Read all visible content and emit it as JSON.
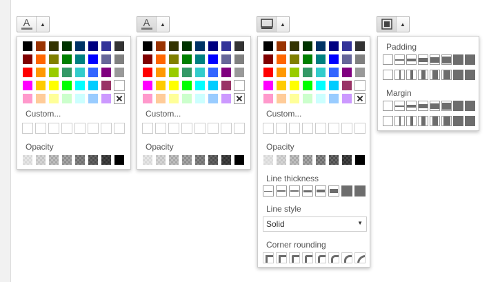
{
  "toolbar": {
    "font_color_button": "font-color-button",
    "bg_color_button": "background-color-button",
    "border_button": "border-button",
    "spacing_button": "spacing-button"
  },
  "colors": {
    "palette": [
      "#000000",
      "#993300",
      "#333300",
      "#003300",
      "#003366",
      "#000080",
      "#333399",
      "#333333",
      "#800000",
      "#ff6600",
      "#808000",
      "#008000",
      "#008080",
      "#0000ff",
      "#666699",
      "#808080",
      "#ff0000",
      "#ff9900",
      "#99cc00",
      "#339966",
      "#33cccc",
      "#3366ff",
      "#800080",
      "#999999",
      "#ff00ff",
      "#ffcc00",
      "#ffff00",
      "#00ff00",
      "#00ffff",
      "#00ccff",
      "#993366",
      "#ffffff",
      "#ff99cc",
      "#ffcc99",
      "#ffff99",
      "#ccffcc",
      "#ccffff",
      "#99ccff",
      "#cc99ff",
      "none"
    ],
    "opacity_shades": [
      "#d8d8d8",
      "#c4c4c4",
      "#a8a8a8",
      "#8c8c8c",
      "#6c6c6c",
      "#4c4c4c",
      "#2e2e2e",
      "#000000"
    ]
  },
  "popup1": {
    "custom_label": "Custom...",
    "opacity_label": "Opacity"
  },
  "popup2": {
    "custom_label": "Custom...",
    "opacity_label": "Opacity"
  },
  "popup3": {
    "custom_label": "Custom...",
    "opacity_label": "Opacity",
    "line_thickness_label": "Line thickness",
    "line_style_label": "Line style",
    "line_style_value": "Solid",
    "corner_rounding_label": "Corner rounding"
  },
  "popup4": {
    "padding_label": "Padding",
    "margin_label": "Margin"
  },
  "icons": {
    "text_color": "text-color-icon",
    "background_color": "highlight-icon",
    "border": "border-icon",
    "spacing": "box-spacing-icon",
    "dropdown": "chevron-up-icon"
  }
}
